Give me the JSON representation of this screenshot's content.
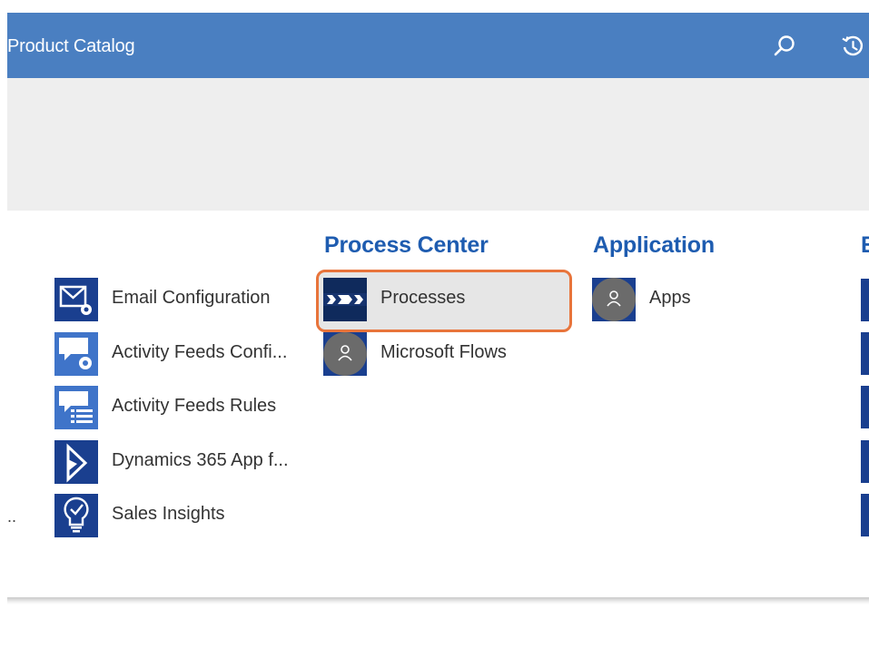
{
  "header": {
    "title": "Product Catalog",
    "search_icon": "search-icon",
    "recent_icon": "history-icon",
    "color": "#4a7fc1"
  },
  "columns": {
    "left_cutoff_text": "..",
    "settings": {
      "items": [
        {
          "label": "Email Configuration",
          "icon": "email-config-icon"
        },
        {
          "label": "Activity Feeds Confi...",
          "icon": "activity-feeds-config-icon"
        },
        {
          "label": "Activity Feeds Rules",
          "icon": "activity-feeds-rules-icon"
        },
        {
          "label": "Dynamics 365 App f...",
          "icon": "dynamics-365-icon"
        },
        {
          "label": "Sales Insights",
          "icon": "sales-insights-icon"
        }
      ]
    },
    "process_center": {
      "title": "Process Center",
      "items": [
        {
          "label": "Processes",
          "icon": "processes-icon",
          "selected": true
        },
        {
          "label": "Microsoft Flows",
          "icon": "user-avatar-icon"
        }
      ]
    },
    "application": {
      "title": "Application",
      "items": [
        {
          "label": "Apps",
          "icon": "user-avatar-icon"
        }
      ]
    },
    "next_group_partial_title": "E"
  },
  "colors": {
    "accent": "#1e5cb0",
    "tile_icon_bg": "#1a3f8f",
    "highlight_border": "#e8743b"
  }
}
